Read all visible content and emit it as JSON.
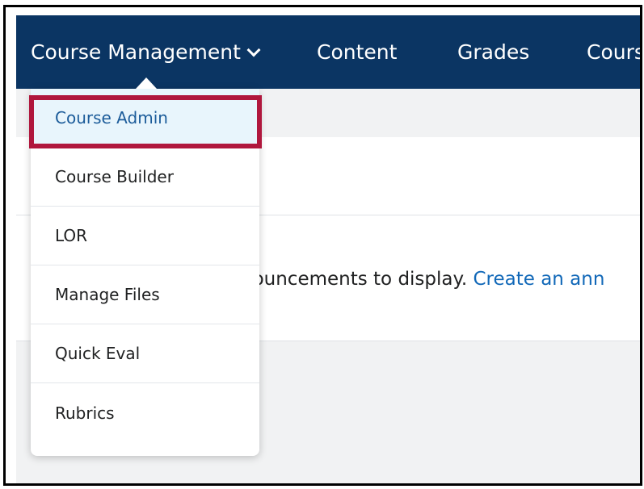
{
  "navbar": {
    "items": [
      {
        "label": "Course Management",
        "has_dropdown": true
      },
      {
        "label": "Content"
      },
      {
        "label": "Grades"
      },
      {
        "label": "Cours"
      }
    ],
    "background": "#0b3563"
  },
  "dropdown": {
    "items": [
      {
        "label": "Course Admin",
        "selected": true
      },
      {
        "label": "Course Builder"
      },
      {
        "label": "LOR"
      },
      {
        "label": "Manage Files"
      },
      {
        "label": "Quick Eval"
      },
      {
        "label": "Rubrics"
      }
    ]
  },
  "announcements": {
    "text": "nouncements to display.",
    "link_text": "Create an ann"
  },
  "annotation": {
    "color": "#b0173d"
  }
}
